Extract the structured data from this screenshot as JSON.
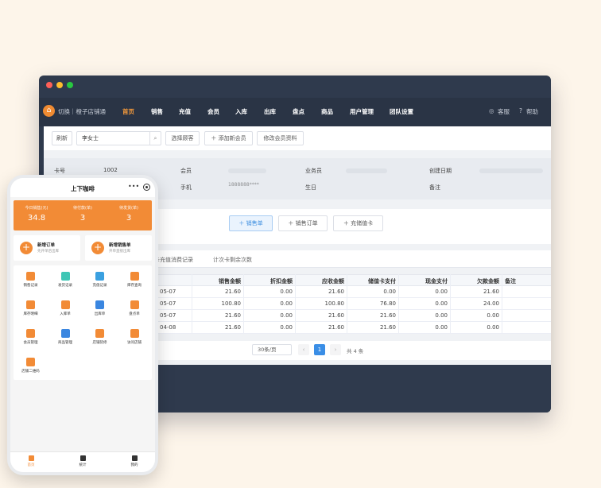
{
  "nav": {
    "brand": "切换｜橙子店铺通",
    "items": [
      "首页",
      "销售",
      "充值",
      "会员",
      "入库",
      "出库",
      "盘点",
      "商品",
      "用户管理",
      "团队设置"
    ],
    "right": [
      "客服",
      "帮助"
    ]
  },
  "toolbar": {
    "refresh": "刷新",
    "search_value": "李女士",
    "choose_customer": "选择顾客",
    "add_member": "＋ 添加新会员",
    "edit_member": "修改会员资料"
  },
  "info": {
    "card_label": "卡号",
    "card_value": "1002",
    "member_label": "会员",
    "phone_label": "手机",
    "phone_value": "1888888****",
    "sales_label": "业务员",
    "birthday_label": "生日",
    "created_label": "创建日期",
    "note_label": "备注"
  },
  "actions": {
    "sale": "＋ 销售单",
    "sale_order": "＋ 销售订单",
    "recharge": "＋ 充储值卡"
  },
  "tabs": [
    "次卡充值消费记录",
    "计次卡剩余次数"
  ],
  "table": {
    "headers": [
      "销售金额",
      "折扣金额",
      "应收金额",
      "储值卡支付",
      "现金支付",
      "欠款金额",
      "备注"
    ],
    "rows": [
      {
        "date": "05-07",
        "sale": "21.60",
        "discount": "0.00",
        "receivable": "21.60",
        "card": "0.00",
        "cash": "0.00",
        "debt": "21.60"
      },
      {
        "date": "05-07",
        "sale": "100.80",
        "discount": "0.00",
        "receivable": "100.80",
        "card": "76.80",
        "cash": "0.00",
        "debt": "24.00"
      },
      {
        "date": "05-07",
        "sale": "21.60",
        "discount": "0.00",
        "receivable": "21.60",
        "card": "21.60",
        "cash": "0.00",
        "debt": "0.00"
      },
      {
        "date": "04-08",
        "sale": "21.60",
        "discount": "0.00",
        "receivable": "21.60",
        "card": "21.60",
        "cash": "0.00",
        "debt": "0.00"
      }
    ]
  },
  "pager": {
    "page_size": "30条/页",
    "prev": "‹",
    "current": "1",
    "next": "›",
    "total": "共 4 条"
  },
  "phone": {
    "title": "上下咖啡",
    "stats": [
      {
        "label": "今日销售(元)",
        "value": "34.8"
      },
      {
        "label": "待付款(单)",
        "value": "3"
      },
      {
        "label": "待发货(单)",
        "value": "3"
      }
    ],
    "quick": [
      {
        "title": "新增订单",
        "sub": "先开单后出库"
      },
      {
        "title": "新增销售单",
        "sub": "开单直接出库"
      }
    ],
    "grid": [
      {
        "label": "销售记录",
        "color": "#f28b36"
      },
      {
        "label": "发货记录",
        "color": "#3fc6b5"
      },
      {
        "label": "充值记录",
        "color": "#3aa0e0"
      },
      {
        "label": "库存查询",
        "color": "#f28b36"
      },
      {
        "label": "库存明细",
        "color": "#f28b36"
      },
      {
        "label": "入库单",
        "color": "#f28b36"
      },
      {
        "label": "出库单",
        "color": "#3a86e0"
      },
      {
        "label": "盘点单",
        "color": "#f28b36"
      },
      {
        "label": "会员管理",
        "color": "#f28b36"
      },
      {
        "label": "商品管理",
        "color": "#3a86e0"
      },
      {
        "label": "店铺装修",
        "color": "#f28b36"
      },
      {
        "label": "访问店铺",
        "color": "#f28b36"
      },
      {
        "label": "店铺二维码",
        "color": "#f28b36"
      }
    ],
    "tabbar": [
      "首页",
      "统计",
      "我的"
    ]
  }
}
